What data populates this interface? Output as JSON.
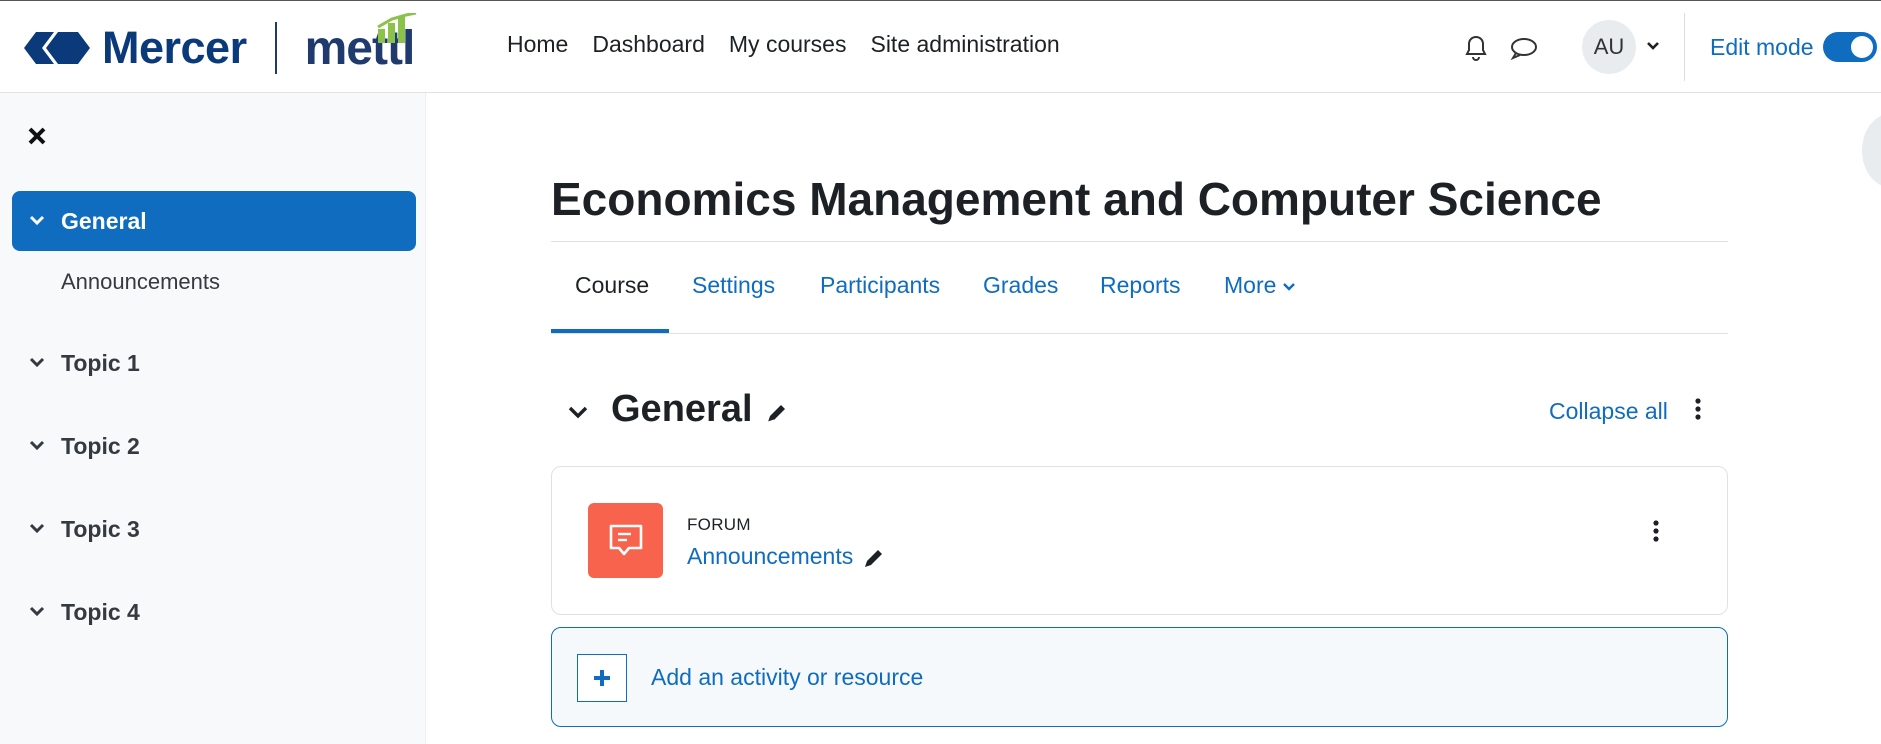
{
  "brand": {
    "mercer_text": "Mercer",
    "mettl_text": "mettl"
  },
  "nav": {
    "links": [
      "Home",
      "Dashboard",
      "My courses",
      "Site administration"
    ]
  },
  "user_menu": {
    "initials": "AU",
    "edit_mode_label": "Edit mode",
    "edit_mode_on": true
  },
  "drawer": {
    "items": [
      {
        "label": "General",
        "active": true
      },
      {
        "label": "Topic 1",
        "active": false
      },
      {
        "label": "Topic 2",
        "active": false
      },
      {
        "label": "Topic 3",
        "active": false
      },
      {
        "label": "Topic 4",
        "active": false
      }
    ],
    "sub_item": "Announcements"
  },
  "course": {
    "title": "Economics Management and Computer Science",
    "tabs": [
      "Course",
      "Settings",
      "Participants",
      "Grades",
      "Reports",
      "More"
    ],
    "active_tab": "Course"
  },
  "section": {
    "title": "General",
    "collapse_all": "Collapse all"
  },
  "activity": {
    "type": "FORUM",
    "name": "Announcements"
  },
  "add_activity": {
    "label": "Add an activity or resource"
  },
  "colors": {
    "accent": "#0f6cbf",
    "forum_icon": "#f7634d",
    "brand_navy": "#0b3a7a"
  }
}
